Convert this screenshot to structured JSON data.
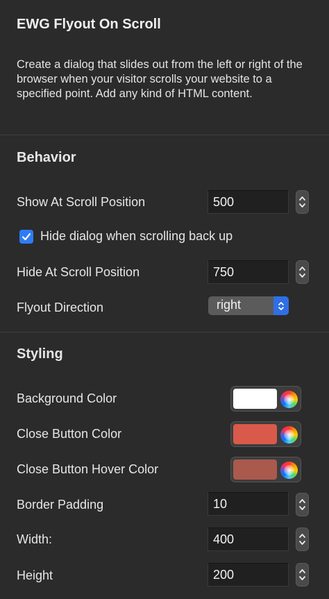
{
  "header": {
    "title": "EWG Flyout On Scroll",
    "description": "Create a dialog that slides out from the left or right of the browser when your visitor scrolls your website to a specified point. Add any kind of HTML content."
  },
  "behavior": {
    "section_title": "Behavior",
    "show_at_scroll": {
      "label": "Show At Scroll Position",
      "value": "500"
    },
    "hide_on_scroll_back": {
      "label": "Hide dialog when scrolling back up",
      "checked": true
    },
    "hide_at_scroll": {
      "label": "Hide At Scroll Position",
      "value": "750"
    },
    "flyout_direction": {
      "label": "Flyout Direction",
      "value": "right"
    }
  },
  "styling": {
    "section_title": "Styling",
    "background_color": {
      "label": "Background Color",
      "color": "#ffffff"
    },
    "close_button_color": {
      "label": "Close Button Color",
      "color": "#d95a4a"
    },
    "close_button_hover_color": {
      "label": "Close Button Hover Color",
      "color": "#a95a4d"
    },
    "border_padding": {
      "label": "Border Padding",
      "value": "10"
    },
    "width": {
      "label": "Width:",
      "value": "400"
    },
    "height": {
      "label": "Height",
      "value": "200"
    }
  },
  "icons": {
    "stepper": "up-down-chevrons-icon",
    "checkbox": "checkmark-icon",
    "color_picker": "color-wheel-icon"
  }
}
